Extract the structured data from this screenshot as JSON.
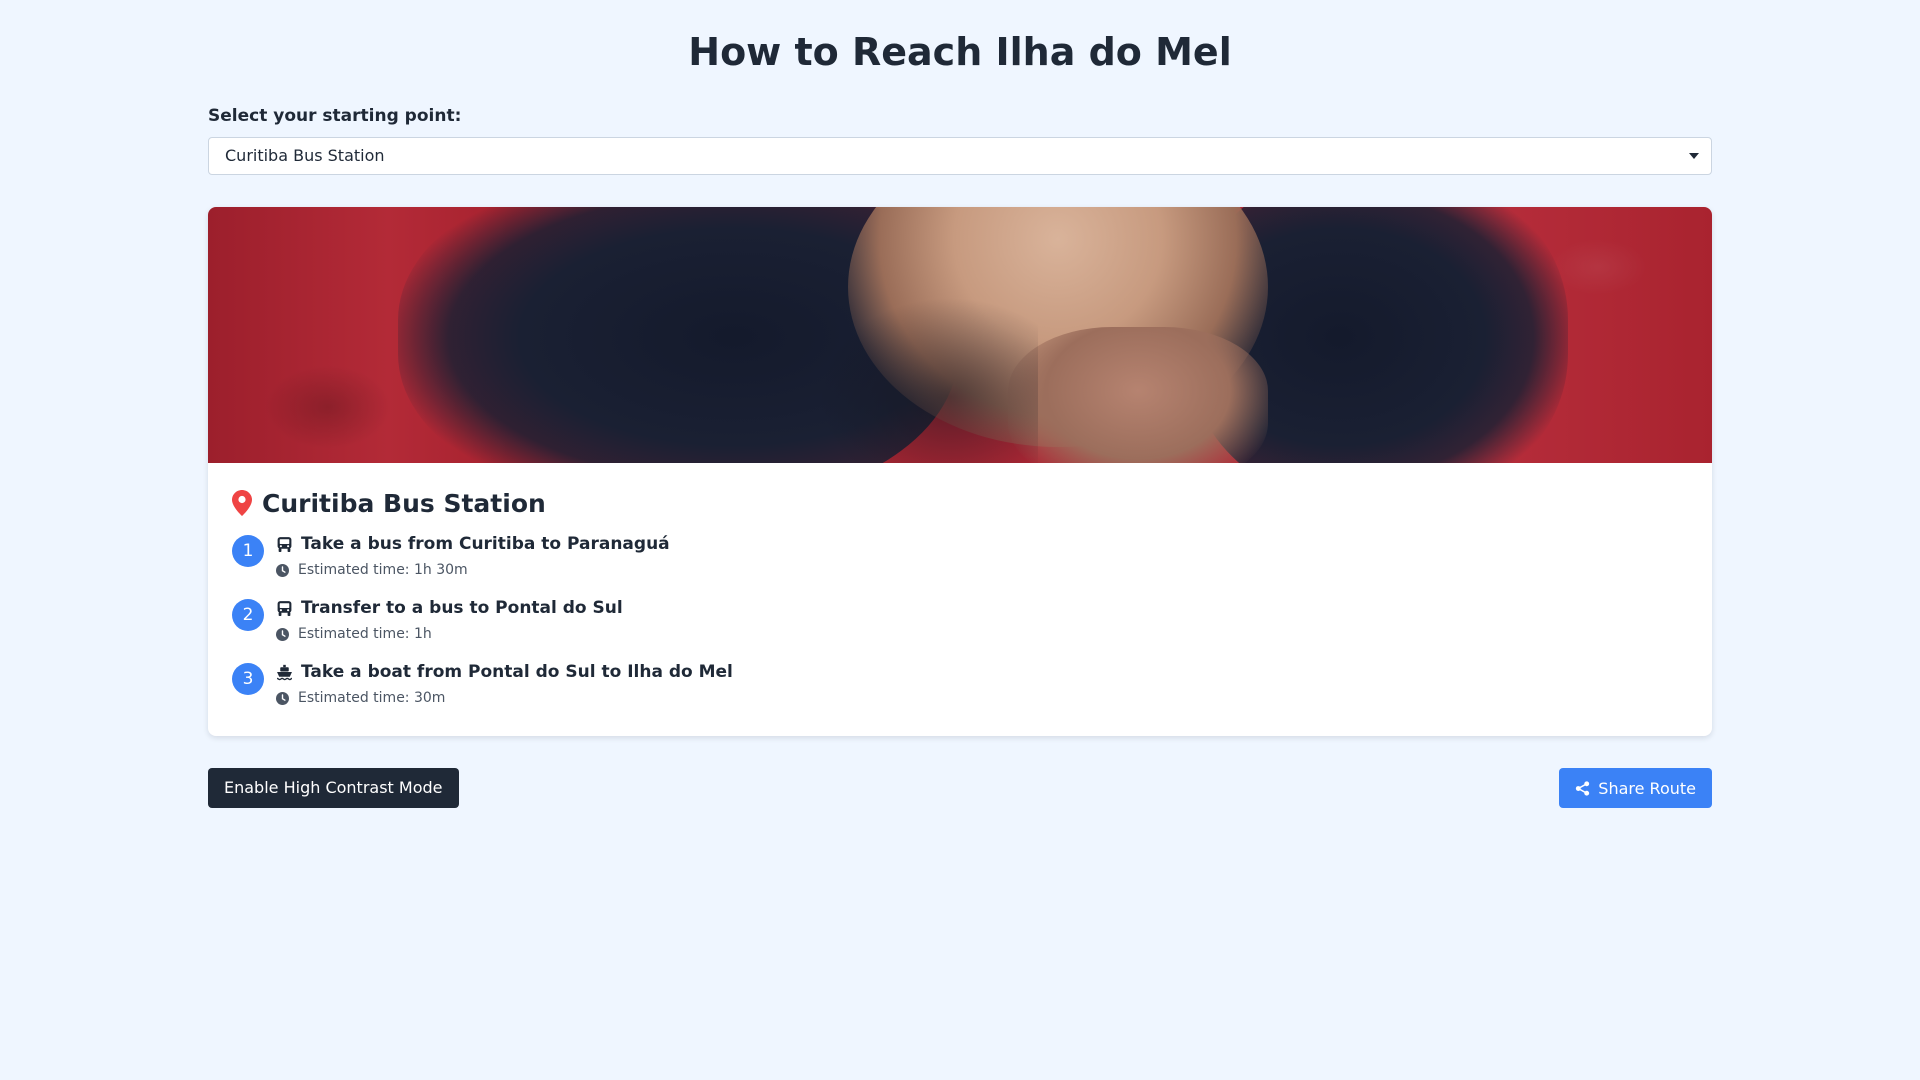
{
  "page": {
    "title": "How to Reach Ilha do Mel"
  },
  "selector": {
    "label": "Select your starting point:",
    "selected": "Curitiba Bus Station"
  },
  "route": {
    "location_name": "Curitiba Bus Station",
    "location_icon": "map-pin-icon",
    "steps": [
      {
        "number": "1",
        "icon": "bus-icon",
        "text": "Take a bus from Curitiba to Paranaguá",
        "time": "Estimated time: 1h 30m"
      },
      {
        "number": "2",
        "icon": "bus-icon",
        "text": "Transfer to a bus to Pontal do Sul",
        "time": "Estimated time: 1h"
      },
      {
        "number": "3",
        "icon": "ship-icon",
        "text": "Take a boat from Pontal do Sul to Ilha do Mel",
        "time": "Estimated time: 30m"
      }
    ]
  },
  "actions": {
    "contrast_label": "Enable High Contrast Mode",
    "share_label": "Share Route"
  },
  "colors": {
    "background": "#eff6ff",
    "accent": "#3b82f6",
    "dark": "#1f2937",
    "pin": "#ef4444"
  }
}
